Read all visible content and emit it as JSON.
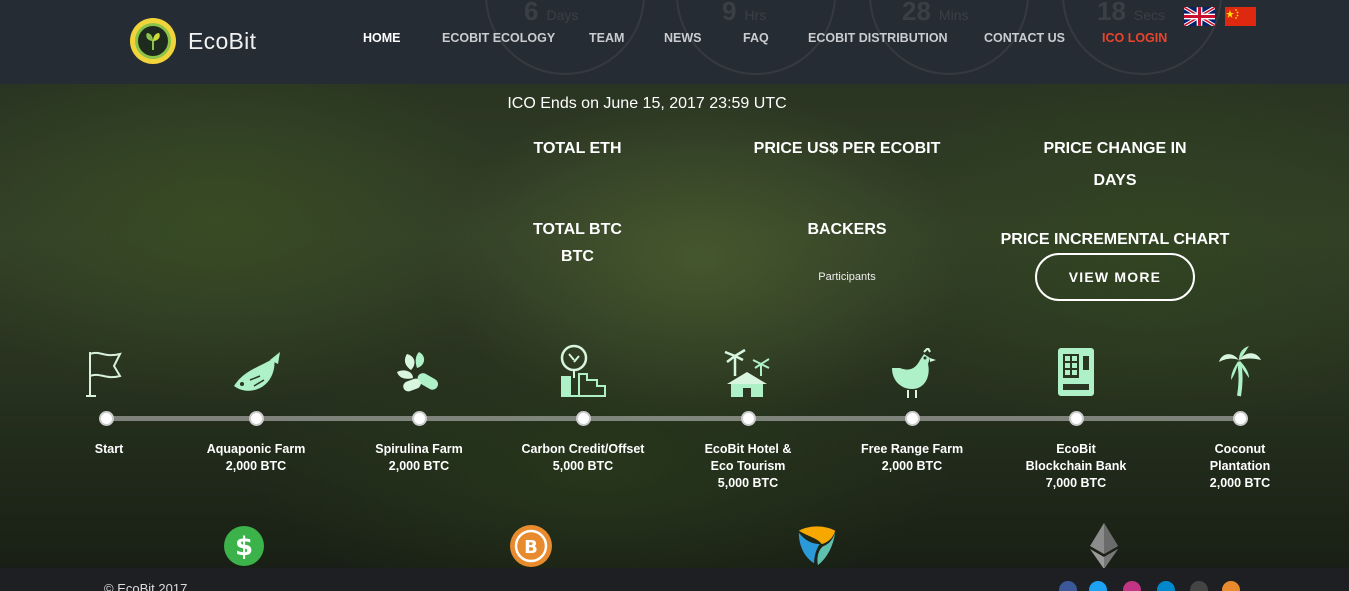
{
  "header": {
    "brand": "EcoBit",
    "countdown": [
      {
        "value": "6",
        "unit": "Days"
      },
      {
        "value": "9",
        "unit": "Hrs"
      },
      {
        "value": "28",
        "unit": "Mins"
      },
      {
        "value": "18",
        "unit": "Secs"
      }
    ],
    "nav": [
      {
        "label": "HOME"
      },
      {
        "label": "ECOBIT ECOLOGY"
      },
      {
        "label": "TEAM"
      },
      {
        "label": "NEWS"
      },
      {
        "label": "FAQ"
      },
      {
        "label": "ECOBIT DISTRIBUTION"
      },
      {
        "label": "CONTACT US"
      },
      {
        "label": "ICO LOGIN"
      }
    ],
    "flags": [
      "uk-flag-icon",
      "china-flag-icon"
    ],
    "accent_color": "#e8452c"
  },
  "ico": {
    "ends": "ICO Ends on June 15, 2017 23:59 UTC",
    "total_eth": "TOTAL ETH",
    "price_usd": "PRICE US$ PER ECOBIT",
    "price_change": "PRICE CHANGE IN",
    "price_change_days": "DAYS",
    "total_btc": "TOTAL BTC",
    "btc": "BTC",
    "backers": "BACKERS",
    "participants": "Participants",
    "incremental_chart": "PRICE INCREMENTAL CHART",
    "view_more": "VIEW MORE"
  },
  "timeline": [
    {
      "label": "Start",
      "amount": "",
      "icon": "flag-icon"
    },
    {
      "label": "Aquaponic Farm",
      "amount": "2,000 BTC",
      "icon": "fish-icon"
    },
    {
      "label": "Spirulina Farm",
      "amount": "2,000 BTC",
      "icon": "spirulina-icon"
    },
    {
      "label": "Carbon Credit/Offset",
      "amount": "5,000 BTC",
      "icon": "carbon-tree-icon"
    },
    {
      "label": "EcoBit Hotel &",
      "label2": "Eco Tourism",
      "amount": "5,000 BTC",
      "icon": "hotel-icon"
    },
    {
      "label": "Free Range Farm",
      "amount": "2,000 BTC",
      "icon": "chicken-icon"
    },
    {
      "label": "EcoBit",
      "label2": "Blockchain Bank",
      "amount": "7,000 BTC",
      "icon": "bank-machine-icon"
    },
    {
      "label": "Coconut",
      "label2": "Plantation",
      "amount": "2,000 BTC",
      "icon": "palm-tree-icon"
    }
  ],
  "currencies": [
    "dollar-icon",
    "bitcoin-icon",
    "nem-icon",
    "ethereum-icon"
  ],
  "footer": {
    "copyright": "© EcoBit 2017",
    "social": [
      "facebook-icon",
      "twitter-icon",
      "instagram-icon",
      "telegram-icon",
      "github-icon",
      "bitcoin-social-icon"
    ]
  }
}
